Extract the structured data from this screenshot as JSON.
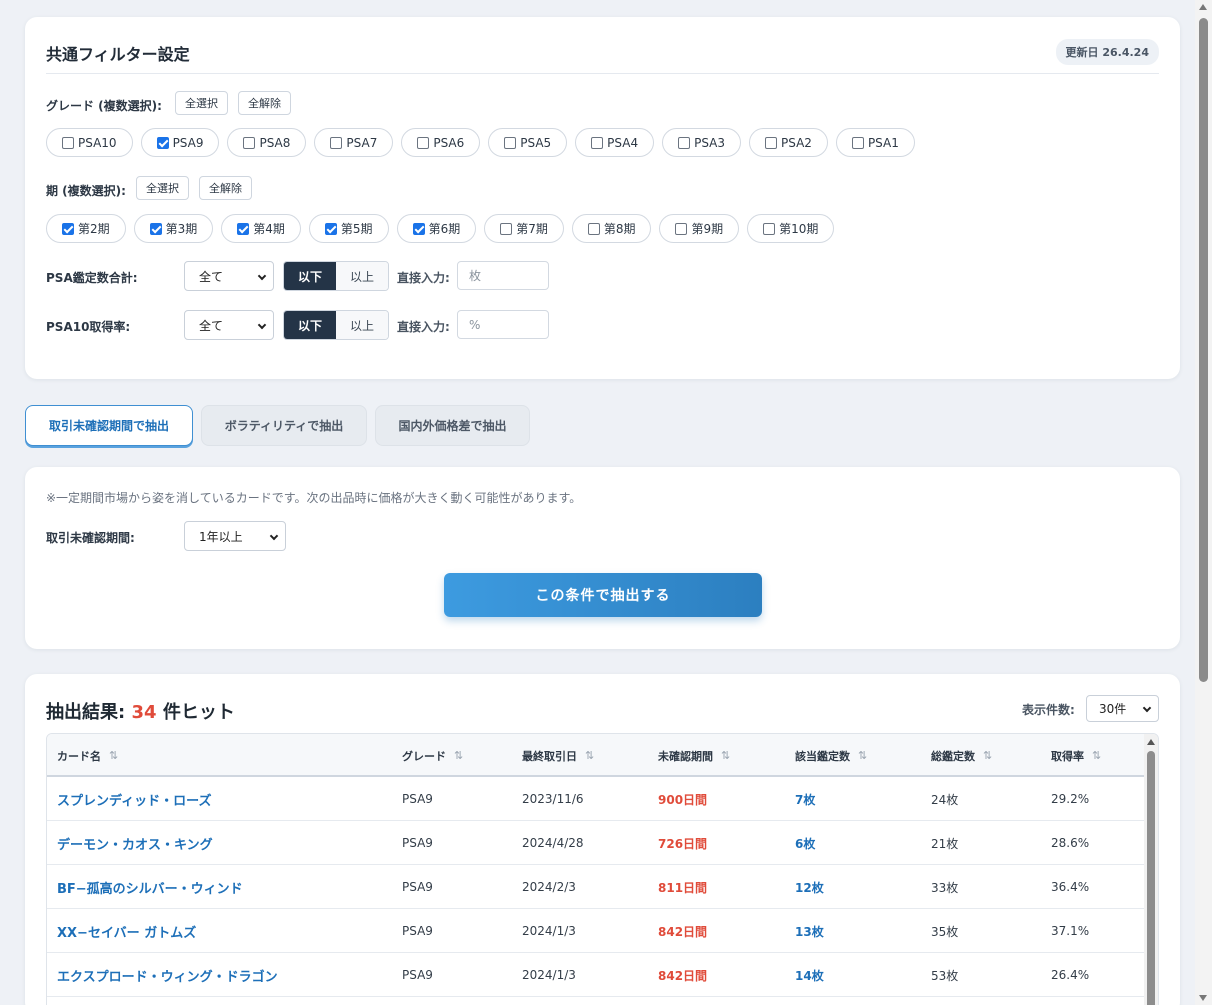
{
  "filters": {
    "title": "共通フィルター設定",
    "update_badge": "更新日 26.4.24",
    "grade": {
      "label": "グレード (複数選択):",
      "select_all": "全選択",
      "clear_all": "全解除",
      "options": [
        {
          "label": "PSA10",
          "checked": false
        },
        {
          "label": "PSA9",
          "checked": true
        },
        {
          "label": "PSA8",
          "checked": false
        },
        {
          "label": "PSA7",
          "checked": false
        },
        {
          "label": "PSA6",
          "checked": false
        },
        {
          "label": "PSA5",
          "checked": false
        },
        {
          "label": "PSA4",
          "checked": false
        },
        {
          "label": "PSA3",
          "checked": false
        },
        {
          "label": "PSA2",
          "checked": false
        },
        {
          "label": "PSA1",
          "checked": false
        }
      ]
    },
    "period": {
      "label": "期 (複数選択):",
      "select_all": "全選択",
      "clear_all": "全解除",
      "options": [
        {
          "label": "第2期",
          "checked": true
        },
        {
          "label": "第3期",
          "checked": true
        },
        {
          "label": "第4期",
          "checked": true
        },
        {
          "label": "第5期",
          "checked": true
        },
        {
          "label": "第6期",
          "checked": true
        },
        {
          "label": "第7期",
          "checked": false
        },
        {
          "label": "第8期",
          "checked": false
        },
        {
          "label": "第9期",
          "checked": false
        },
        {
          "label": "第10期",
          "checked": false
        }
      ]
    },
    "psa_total": {
      "label": "PSA鑑定数合計:",
      "select_value": "全て",
      "seg_below": "以下",
      "seg_above": "以上",
      "direct_label": "直接入力:",
      "input_placeholder": "枚"
    },
    "psa10_rate": {
      "label": "PSA10取得率:",
      "select_value": "全て",
      "seg_below": "以下",
      "seg_above": "以上",
      "direct_label": "直接入力:",
      "input_placeholder": "%"
    }
  },
  "tabs": [
    {
      "label": "取引未確認期間で抽出",
      "active": true
    },
    {
      "label": "ボラティリティで抽出",
      "active": false
    },
    {
      "label": "国内外価格差で抽出",
      "active": false
    }
  ],
  "extract": {
    "note": "※一定期間市場から姿を消しているカードです。次の出品時に価格が大きく動く可能性があります。",
    "period_label": "取引未確認期間:",
    "period_value": "1年以上",
    "button_label": "この条件で抽出する"
  },
  "results": {
    "title_prefix": "抽出結果:",
    "count": "34",
    "title_suffix": "件ヒット",
    "per_page_label": "表示件数:",
    "per_page_value": "30件",
    "sort_icon": "⇅",
    "columns": [
      "カード名",
      "グレード",
      "最終取引日",
      "未確認期間",
      "該当鑑定数",
      "総鑑定数",
      "取得率"
    ],
    "rows": [
      {
        "name": "スプレンディッド・ローズ",
        "grade": "PSA9",
        "last_trade": "2023/11/6",
        "unconfirmed": "900日間",
        "graded": "7枚",
        "total": "24枚",
        "rate": "29.2%"
      },
      {
        "name": "デーモン・カオス・キング",
        "grade": "PSA9",
        "last_trade": "2024/4/28",
        "unconfirmed": "726日間",
        "graded": "6枚",
        "total": "21枚",
        "rate": "28.6%"
      },
      {
        "name": "BF−孤高のシルバー・ウィンド",
        "grade": "PSA9",
        "last_trade": "2024/2/3",
        "unconfirmed": "811日間",
        "graded": "12枚",
        "total": "33枚",
        "rate": "36.4%"
      },
      {
        "name": "XX−セイバー ガトムズ",
        "grade": "PSA9",
        "last_trade": "2024/1/3",
        "unconfirmed": "842日間",
        "graded": "13枚",
        "total": "35枚",
        "rate": "37.1%"
      },
      {
        "name": "エクスプロード・ウィング・ドラゴン",
        "grade": "PSA9",
        "last_trade": "2024/1/3",
        "unconfirmed": "842日間",
        "graded": "14枚",
        "total": "53枚",
        "rate": "26.4%"
      }
    ]
  }
}
